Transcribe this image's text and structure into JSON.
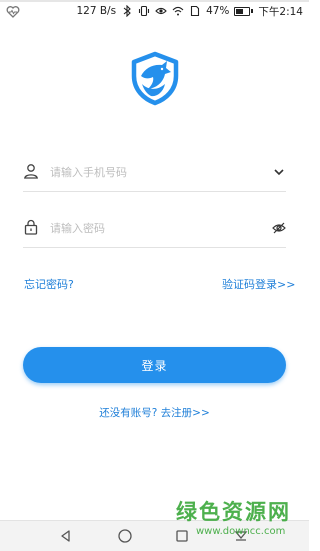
{
  "status_bar": {
    "network_speed": "127 B/s",
    "battery_percent": "47%",
    "time": "下午2:14"
  },
  "logo": {
    "icon": "shield-dragon-logo",
    "color": "#2590ec"
  },
  "phone_field": {
    "placeholder": "请输入手机号码",
    "lead_icon": "user-icon",
    "trail_icon": "chevron-down-icon"
  },
  "password_field": {
    "placeholder": "请输入密码",
    "lead_icon": "lock-icon",
    "trail_icon": "eye-off-icon"
  },
  "links": {
    "forgot_password": "忘记密码?",
    "code_login": "验证码登录>>",
    "register": "还没有账号? 去注册>>"
  },
  "login_button": {
    "label": "登录"
  },
  "nav_bar": {
    "buttons": [
      "back-icon",
      "home-icon",
      "recents-icon",
      "dropdown-icon"
    ]
  },
  "watermark": {
    "title": "绿色资源网",
    "url": "www.downcc.com"
  },
  "colors": {
    "accent": "#2590ec",
    "link": "#1f7fd8",
    "watermark": "#3aa83a"
  }
}
